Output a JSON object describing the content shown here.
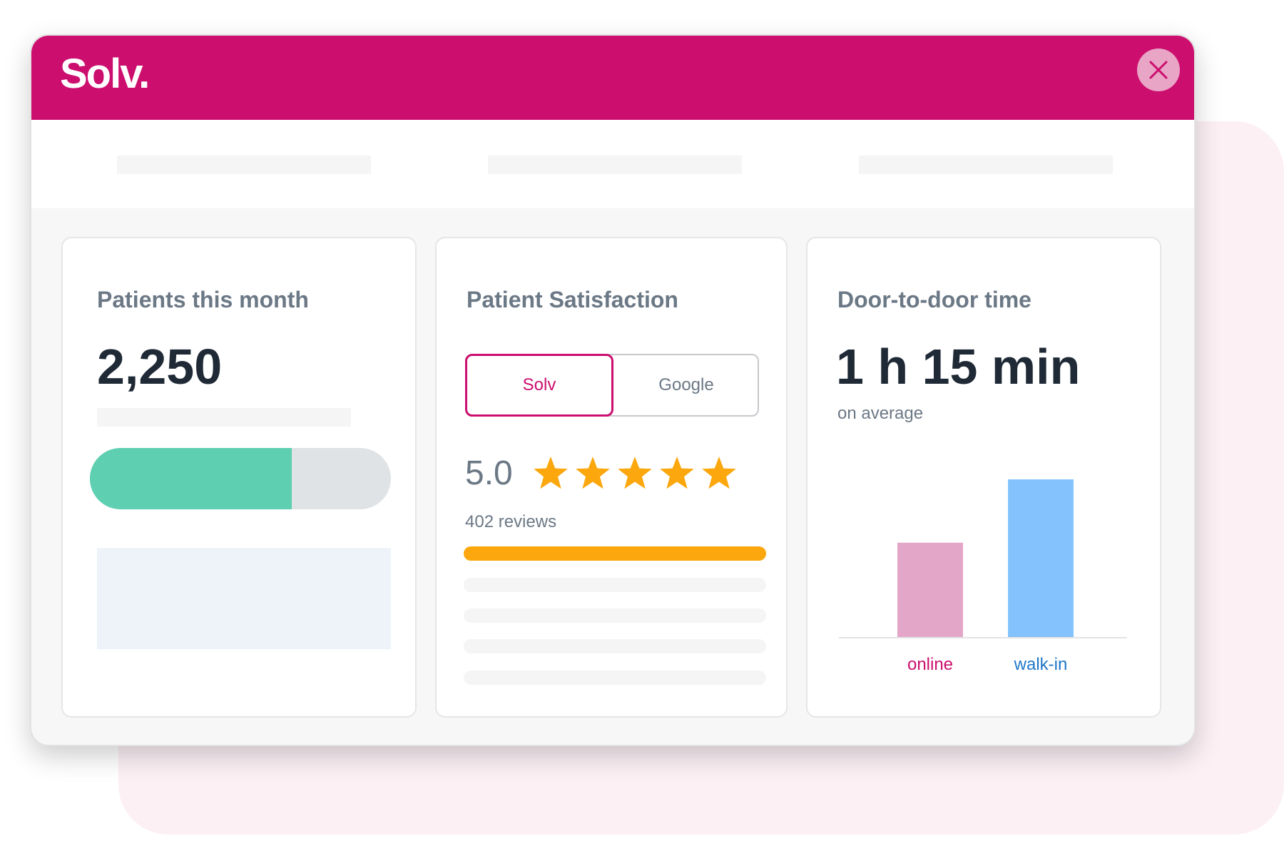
{
  "app": {
    "logo": "Solv."
  },
  "cards": {
    "patients": {
      "title": "Patients this month",
      "value": "2,250",
      "progress": 0.67
    },
    "satisfaction": {
      "title": "Patient Satisfaction",
      "tabs": [
        {
          "label": "Solv",
          "active": true
        },
        {
          "label": "Google",
          "active": false
        }
      ],
      "rating": "5.0",
      "stars": 5,
      "reviews": "402 reviews"
    },
    "door": {
      "title": "Door-to-door time",
      "value": "1 h 15 min",
      "subtext": "on average",
      "chart_data": {
        "type": "bar",
        "categories": [
          "online",
          "walk-in"
        ],
        "values": [
          60,
          100
        ],
        "ylim": [
          0,
          100
        ],
        "colors": [
          "#e4a6c8",
          "#84c2fd"
        ],
        "label_colors": [
          "#cc0e6e",
          "#1f77c9"
        ]
      }
    }
  },
  "colors": {
    "brand": "#cc0e6e",
    "progress_fill": "#5ecfb1",
    "star": "#fba70d",
    "text_dark": "#1f2a36",
    "text_muted": "#6b7885"
  },
  "icons": {
    "close": "close-icon",
    "star": "star-icon"
  }
}
